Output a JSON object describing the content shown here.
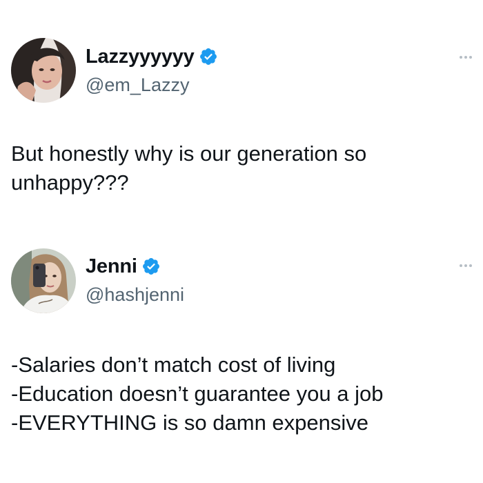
{
  "tweets": [
    {
      "display_name": "Lazzyyyyyy",
      "handle": "@em_Lazzy",
      "verified_icon": "verified-badge-icon",
      "more_icon": "more-options-icon",
      "text_lines": [
        "But honestly why is our generation so",
        "unhappy???"
      ]
    },
    {
      "display_name": "Jenni",
      "handle": "@hashjenni",
      "verified_icon": "verified-badge-icon",
      "more_icon": "more-options-icon",
      "text_lines": [
        "-Salaries don’t match cost of living",
        "-Education doesn’t guarantee you a job",
        "-EVERYTHING is so damn expensive"
      ]
    }
  ],
  "colors": {
    "verified_blue": "#1d9bf0",
    "text_primary": "#0f1419",
    "text_secondary": "#536471",
    "more_dots": "#b6bec5"
  }
}
